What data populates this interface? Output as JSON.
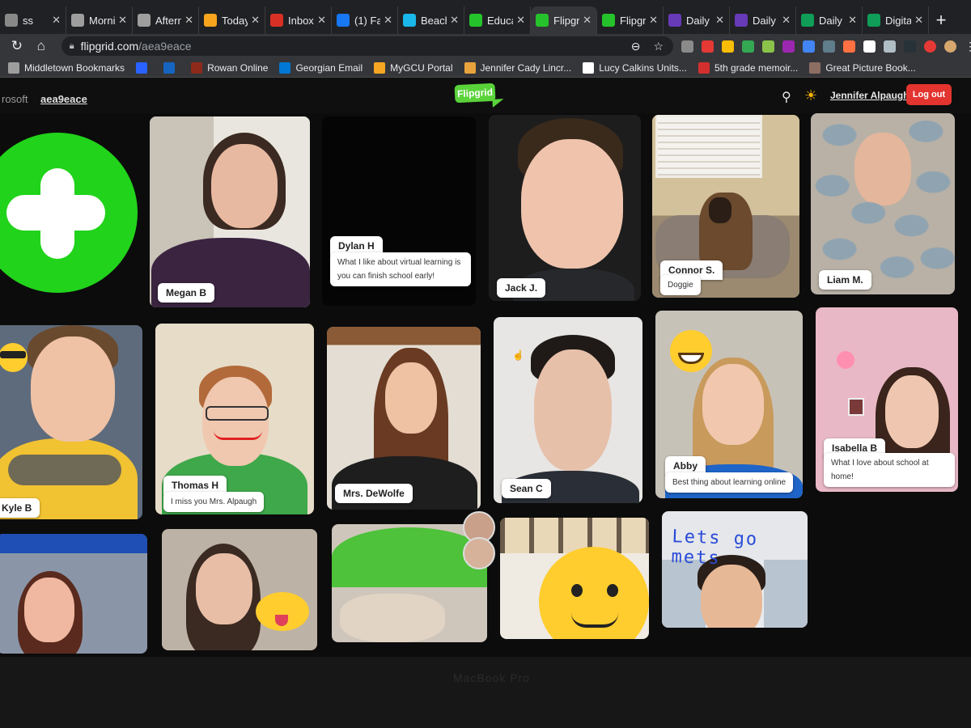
{
  "browser": {
    "tabs": [
      {
        "title": "ss",
        "fav": "#888888",
        "active": false
      },
      {
        "title": "Morni",
        "fav": "#9e9e9e",
        "active": false
      },
      {
        "title": "Aftern",
        "fav": "#9e9e9e",
        "active": false
      },
      {
        "title": "Today",
        "fav": "#f7a51d",
        "active": false
      },
      {
        "title": "Inbox",
        "fav": "#d93025",
        "active": false
      },
      {
        "title": "(1) Fa",
        "fav": "#1877f2",
        "active": false
      },
      {
        "title": "Beach",
        "fav": "#1ab7ea",
        "active": false
      },
      {
        "title": "Educa",
        "fav": "#26c22b",
        "active": false
      },
      {
        "title": "Flipgr",
        "fav": "#26c22b",
        "active": true
      },
      {
        "title": "Flipgr",
        "fav": "#26c22b",
        "active": false
      },
      {
        "title": "Daily",
        "fav": "#673ab7",
        "active": false
      },
      {
        "title": "Daily",
        "fav": "#673ab7",
        "active": false
      },
      {
        "title": "Daily",
        "fav": "#0f9d58",
        "active": false
      },
      {
        "title": "Digita",
        "fav": "#0f9d58",
        "active": false
      }
    ],
    "new_tab_glyph": "+",
    "url_domain": "flipgrid.com",
    "url_path": "/aea9eace"
  },
  "bookmarks": [
    {
      "label": "Middletown Bookmarks",
      "icon": "#9e9e9e"
    },
    {
      "label": "",
      "icon": "#2962ff"
    },
    {
      "label": "",
      "icon": "#1565c0"
    },
    {
      "label": "Rowan Online",
      "icon": "#8d2a1a"
    },
    {
      "label": "Georgian Email",
      "icon": "#0078d4"
    },
    {
      "label": "MyGCU Portal",
      "icon": "#f5a623"
    },
    {
      "label": "Jennifer Cady Lincr...",
      "icon": "#e8a33d"
    },
    {
      "label": "Lucy Calkins Units...",
      "icon": "#ffffff"
    },
    {
      "label": "5th grade memoir...",
      "icon": "#d32f2f"
    },
    {
      "label": "Great Picture Book...",
      "icon": "#8d6e63"
    }
  ],
  "flipgrid": {
    "crumb": "rosoft",
    "grid_code": "aea9eace",
    "logo": "Flipgrid",
    "user_name": "Jennifer Alpaugh",
    "logout_label": "Log out",
    "accent": "#5ad33a",
    "logout_color": "#e3342f"
  },
  "tiles": [
    {
      "name": "Megan B",
      "caption": ""
    },
    {
      "name": "Dylan H",
      "caption": "What I like about virtual learning is you can finish school early!"
    },
    {
      "name": "Jack J.",
      "caption": ""
    },
    {
      "name": "Connor S.",
      "caption": "Doggie"
    },
    {
      "name": "Liam M.",
      "caption": ""
    },
    {
      "name": "Kyle B",
      "caption": ""
    },
    {
      "name": "Thomas H",
      "caption": "I miss you Mrs. Alpaugh"
    },
    {
      "name": "Mrs. DeWolfe",
      "caption": ""
    },
    {
      "name": "Sean C",
      "caption": ""
    },
    {
      "name": "Abby",
      "caption": "Best thing about learning online"
    },
    {
      "name": "Isabella B",
      "caption": "What I love about school at home!"
    }
  ],
  "stickers": {
    "lets_go_mets": "Lets go mets"
  },
  "laptop_brand": "MacBook Pro"
}
